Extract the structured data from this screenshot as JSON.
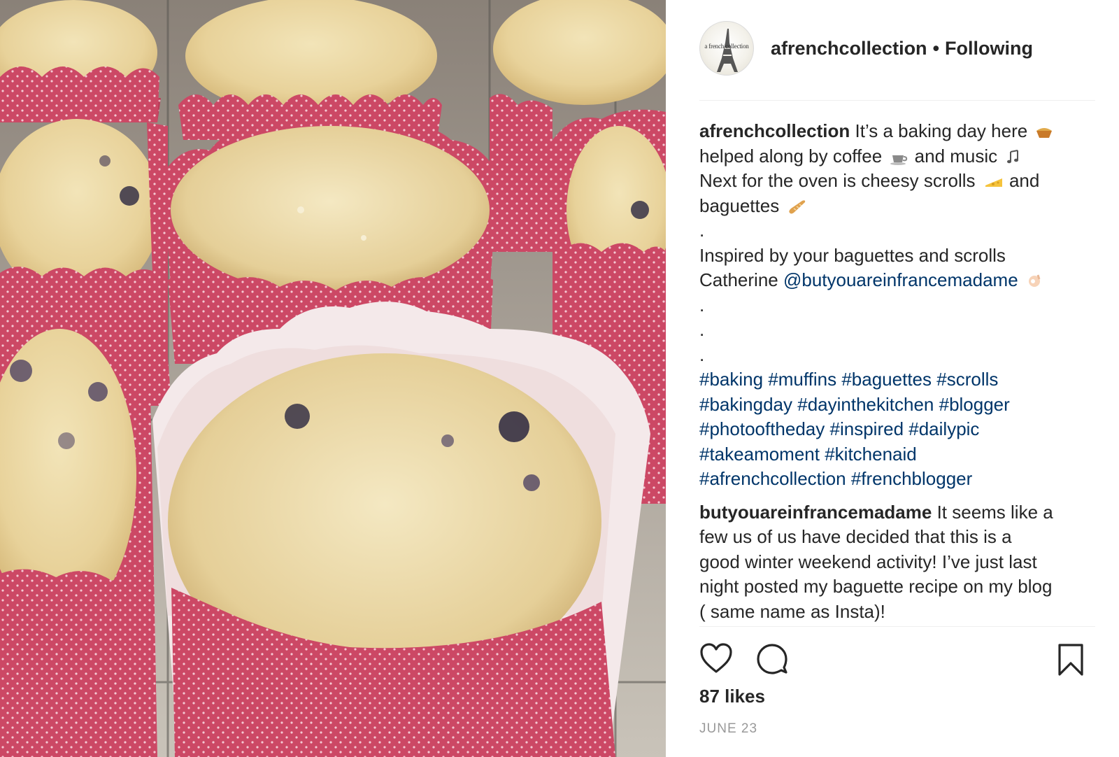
{
  "post": {
    "photo_alt": "Blueberry muffins in pink polka-dot paper wrappers on a cooling rack",
    "username": "afrenchcollection",
    "avatar_text": "a french collection",
    "separator": "•",
    "follow_status": "Following"
  },
  "caption": {
    "username": "afrenchcollection",
    "line1": "It’s a baking day here",
    "line2": "helped along by coffee",
    "line2b": "and music",
    "line3": "Next for the oven is cheesy scrolls",
    "line3b": "and",
    "line4": "baguettes",
    "dot": ".",
    "line5": "Inspired by your baguettes and scrolls",
    "line6": "Catherine",
    "mention": "@butyouareinfrancemadame",
    "hashtags": [
      [
        "#baking",
        "#muffins",
        "#baguettes",
        "#scrolls"
      ],
      [
        "#bakingday",
        "#dayinthekitchen",
        "#blogger"
      ],
      [
        "#photooftheday",
        "#inspired",
        "#dailypic"
      ],
      [
        "#takeamoment",
        "#kitchenaid"
      ],
      [
        "#afrenchcollection",
        "#frenchblogger"
      ]
    ]
  },
  "comment": {
    "username": "butyouareinfrancemadame",
    "line1": "It seems like a",
    "line2": "few us of us have decided that this is a",
    "line3": "good winter weekend activity! I’ve just last",
    "line4": "night posted my baguette recipe on my blog",
    "line5": "( same name as Insta)!"
  },
  "actions": {
    "like_icon": "heart-icon",
    "comment_icon": "comment-bubble-icon",
    "save_icon": "bookmark-icon"
  },
  "likes": "87 likes",
  "date": "JUNE 23",
  "colors": {
    "link": "#003569",
    "text": "#262626",
    "muted": "#999999",
    "wrapper_pink": "#cf4a68"
  }
}
